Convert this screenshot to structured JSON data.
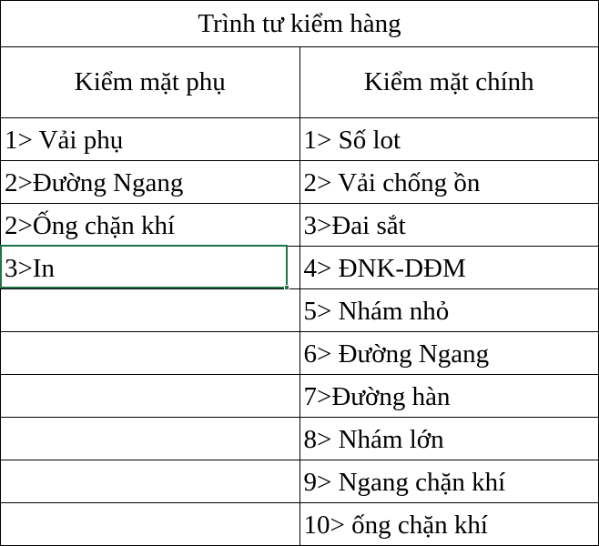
{
  "sheet": {
    "title": "Trình tư kiểm hàng",
    "columns": {
      "left": "Kiểm mặt phụ",
      "right": "Kiểm mặt chính"
    },
    "rows": [
      {
        "left": "1> Vải phụ",
        "right": "1> Số lot"
      },
      {
        "left": "2>Đường Ngang",
        "right": "2> Vải chống ồn"
      },
      {
        "left": "2>Ống chặn khí",
        "right": "3>Đai sắt"
      },
      {
        "left": "3>In",
        "right": "4> ĐNK-DĐM"
      },
      {
        "left": "",
        "right": "5> Nhám nhỏ"
      },
      {
        "left": "",
        "right": "6> Đường Ngang"
      },
      {
        "left": "",
        "right": "7>Đường hàn"
      },
      {
        "left": "",
        "right": "8> Nhám lớn"
      },
      {
        "left": "",
        "right": "9> Ngang chặn khí"
      },
      {
        "left": "",
        "right": "10> ống chặn khí"
      }
    ],
    "selection_color": "#217346"
  }
}
